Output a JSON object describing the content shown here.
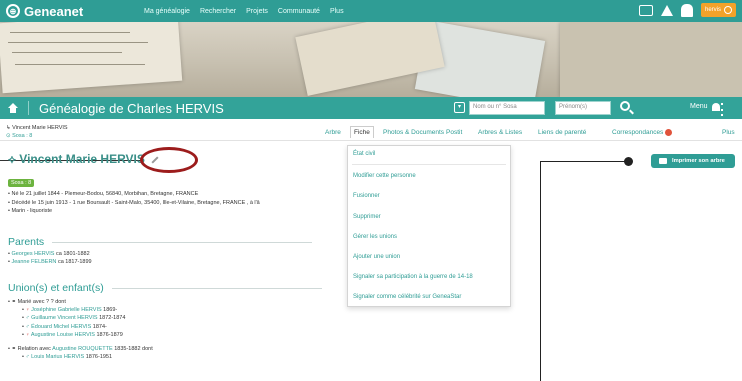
{
  "topbar": {
    "logo": "Geneanet",
    "nav": [
      "Ma généalogie",
      "Rechercher",
      "Projets",
      "Communauté",
      "Plus"
    ],
    "user_label": "hervis"
  },
  "titlebar": {
    "title": "Généalogie de Charles HERVIS",
    "sosa_placeholder": "Nom ou n° Sosa",
    "firstname_placeholder": "Prénom(s)",
    "menu_label": "Menu"
  },
  "breadcrumb": {
    "person": "Vincent Marie HERVIS",
    "sosa": "Sosa : 8"
  },
  "tabs": [
    {
      "label": "Arbre"
    },
    {
      "label": "Fiche"
    },
    {
      "label": "Photos & Documents"
    },
    {
      "label": "Postit"
    },
    {
      "label": "Arbres & Listes"
    },
    {
      "label": "Liens de parenté"
    },
    {
      "label": "Correspondances"
    },
    {
      "label": "Plus"
    }
  ],
  "person": {
    "name": "Vincent Marie HERVIS",
    "sosa_badge": "Sosa : 8",
    "facts": [
      "Né le 21 juillet 1844 - Plemeur-Bodou, 56840, Morbihan, Bretagne, FRANCE",
      "Décédé le 15 juin 1913 - 1 rue Boursault - Saint-Malo, 35400, Ille-et-Vilaine, Bretagne, FRANCE , à l'â",
      "Marin - liquoriste"
    ]
  },
  "parents": {
    "heading": "Parents",
    "items": [
      {
        "name": "Georges HERVIS",
        "dates": " ca 1801-1882"
      },
      {
        "name": "Jeanne FELBERN",
        "dates": " ca 1817-1899"
      }
    ]
  },
  "unions": {
    "heading": "Union(s) et enfant(s)",
    "union1": "Marié avec ? ? dont",
    "children1": [
      {
        "sex": "F",
        "name": "Joséphine Gabrielle HERVIS",
        "dates": " 1869-"
      },
      {
        "sex": "M",
        "name": "Guillaume Vincent HERVIS",
        "dates": " 1872-1874"
      },
      {
        "sex": "M",
        "name": "Édouard Michel HERVIS",
        "dates": " 1874-"
      },
      {
        "sex": "F",
        "name": "Augustine Louise HERVIS",
        "dates": " 1876-1879"
      }
    ],
    "union2_prefix": "Relation avec ",
    "union2_name": "Augustine ROUQUETTE",
    "union2_suffix": " 1835-1882 dont",
    "children2": [
      {
        "sex": "M",
        "name": "Louis Marius HERVIS",
        "dates": " 1876-1951"
      }
    ]
  },
  "dropdown": {
    "items": [
      "État civil",
      "Modifier cette personne",
      "Fusionner",
      "Supprimer",
      "Gérer les unions",
      "Ajouter une union",
      "Signaler sa participation à la guerre de 14-18",
      "Signaler comme célébrité sur GeneaStar"
    ]
  },
  "print_button": "Imprimer son arbre",
  "colors": {
    "teal": "#2f9d95",
    "annotation_ring": "#9c1c1c",
    "alert": "#e0533b"
  }
}
